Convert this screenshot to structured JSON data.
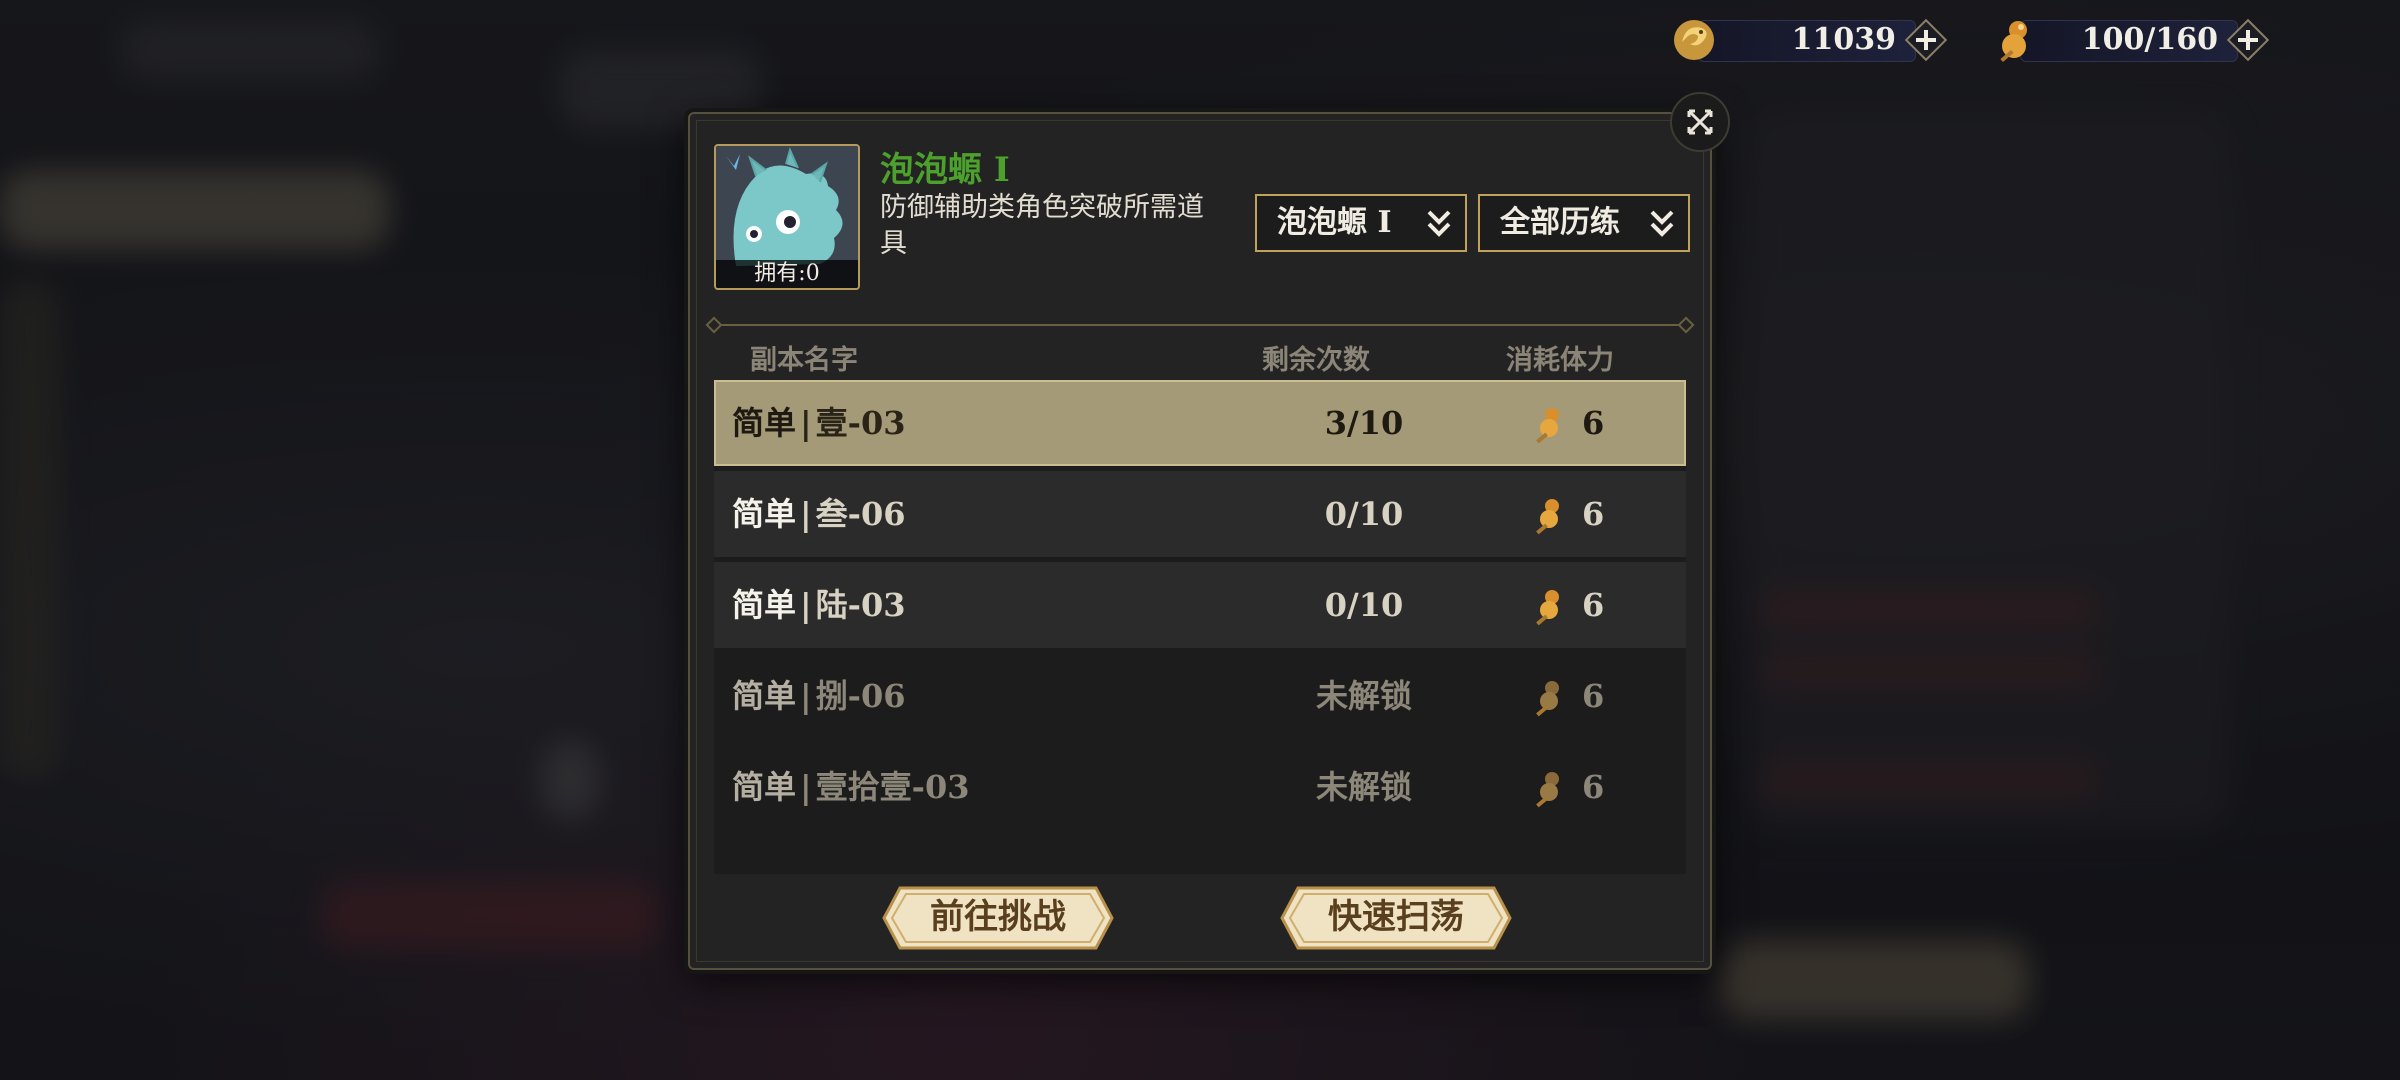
{
  "resources": {
    "currency": {
      "icon": "dragon-coin-icon",
      "value": "11039"
    },
    "stamina": {
      "icon": "stamina-gourd-icon",
      "value": "100/160"
    }
  },
  "item": {
    "name": "泡泡螈 I",
    "description": "防御辅助类角色突破所需道具",
    "owned": "拥有:0",
    "name_color": "#4ca12c"
  },
  "filters": {
    "item_select": "泡泡螈 I",
    "stage_select": "全部历练"
  },
  "table": {
    "headers": [
      "副本名字",
      "剩余次数",
      "消耗体力"
    ],
    "rows": [
      {
        "difficulty": "简单",
        "stage": "壹-03",
        "remaining": "3/10",
        "cost": "6",
        "selected": true,
        "locked": false
      },
      {
        "difficulty": "简单",
        "stage": "叁-06",
        "remaining": "0/10",
        "cost": "6",
        "selected": false,
        "locked": false
      },
      {
        "difficulty": "简单",
        "stage": "陆-03",
        "remaining": "0/10",
        "cost": "6",
        "selected": false,
        "locked": false
      },
      {
        "difficulty": "简单",
        "stage": "捌-06",
        "remaining": "未解锁",
        "cost": "6",
        "selected": false,
        "locked": true
      },
      {
        "difficulty": "简单",
        "stage": "壹拾壹-03",
        "remaining": "未解锁",
        "cost": "6",
        "selected": false,
        "locked": true
      }
    ]
  },
  "buttons": {
    "challenge": "前往挑战",
    "sweep": "快速扫荡"
  },
  "colors": {
    "selected_row": "#a59a77",
    "accent_gold": "#c0a25b",
    "button_fill": "#efe3c4"
  }
}
